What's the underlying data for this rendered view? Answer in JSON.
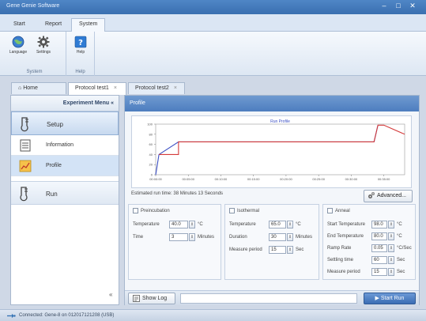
{
  "app": {
    "title": "Gene Genie Software"
  },
  "ribbon": {
    "tabs": [
      "Start",
      "Report",
      "System"
    ],
    "active_tab": "System",
    "groups": [
      {
        "label": "System",
        "buttons": [
          {
            "label": "Language",
            "icon": "globe-icon"
          },
          {
            "label": "Settings",
            "icon": "gear-icon"
          }
        ]
      },
      {
        "label": "Help",
        "buttons": [
          {
            "label": "Help",
            "icon": "help-icon"
          }
        ]
      }
    ]
  },
  "doc_tabs": [
    {
      "label": "Home",
      "icon": "home-icon"
    },
    {
      "label": "Protocol test1",
      "close": "×"
    },
    {
      "label": "Protocol test2",
      "close": "×"
    }
  ],
  "sidebar": {
    "header": "Experiment Menu",
    "collapse_glyph": "«",
    "setup": {
      "label": "Setup",
      "icon": "thermometer-icon"
    },
    "items": [
      {
        "label": "Information",
        "icon": "document-icon"
      },
      {
        "label": "Profile",
        "icon": "chart-icon"
      }
    ],
    "run": {
      "label": "Run",
      "icon": "thermometer-icon"
    },
    "bottom_glyph": "«"
  },
  "profile": {
    "section_title": "Profile",
    "estimated_time": "Estimated run time: 38 Minutes 13 Seconds",
    "advanced_label": "Advanced...",
    "preincubation": {
      "title": "Preincubation",
      "rows": [
        {
          "label": "Temperature",
          "value": "40.0",
          "unit": "°C"
        },
        {
          "label": "Time",
          "value": "3",
          "unit": "Minutes"
        }
      ]
    },
    "isothermal": {
      "title": "Isothermal",
      "rows": [
        {
          "label": "Temperature",
          "value": "65.0",
          "unit": "°C"
        },
        {
          "label": "Duration",
          "value": "30",
          "unit": "Minutes"
        },
        {
          "label": "Measure period",
          "value": "15",
          "unit": "Sec"
        }
      ]
    },
    "anneal": {
      "title": "Anneal",
      "rows": [
        {
          "label": "Start Temperature",
          "value": "98.0",
          "unit": "°C"
        },
        {
          "label": "End Temperature",
          "value": "80.0",
          "unit": "°C"
        },
        {
          "label": "Ramp Rate",
          "value": "0.05",
          "unit": "°C/Sec"
        },
        {
          "label": "Settling time",
          "value": "60",
          "unit": "Sec"
        },
        {
          "label": "Measure period",
          "value": "15",
          "unit": "Sec"
        }
      ]
    }
  },
  "bottom": {
    "show_log": "Show Log",
    "start_run": "Start Run"
  },
  "status": {
    "text": "Connected: Gene-8 on 012017121208 (USB)"
  },
  "chart_data": {
    "type": "line",
    "title": "Run Profile",
    "xlabel": "",
    "ylabel": "",
    "ylim": [
      0,
      100
    ],
    "y_ticks": [
      "100",
      "80",
      "60",
      "40",
      "20",
      "0"
    ],
    "x_ticks": [
      "00:00:00",
      "00:05:00",
      "00:10:00",
      "00:15:00",
      "00:20:00",
      "00:25:00",
      "00:30:00",
      "00:35:00"
    ],
    "xlim": [
      0,
      38.2
    ],
    "series": [
      {
        "color": "#3b4fc4",
        "x": [
          0,
          0.5,
          3.5,
          33.5,
          34.1
        ],
        "y": [
          0,
          40,
          65,
          65,
          98
        ]
      },
      {
        "color": "#d43a3a",
        "x": [
          0.5,
          3.5,
          3.5,
          33.5,
          34.1,
          35.0,
          38.2
        ],
        "y": [
          40,
          40,
          65,
          65,
          98,
          98,
          80
        ]
      }
    ]
  },
  "colors": {
    "accent": "#4d7dbf",
    "titlebar": "#3a6fb0"
  }
}
